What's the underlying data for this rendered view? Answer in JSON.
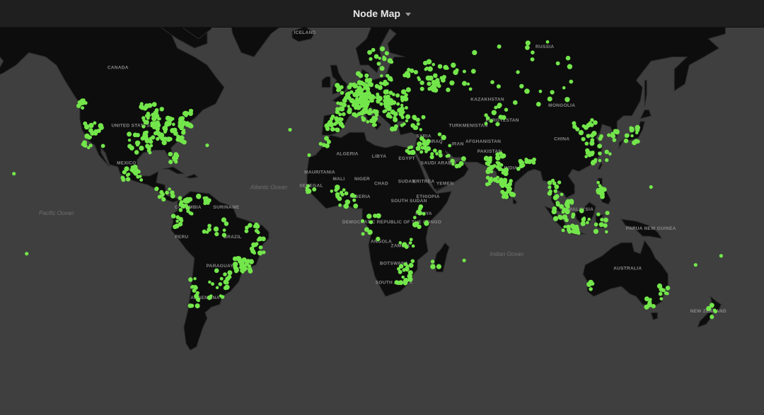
{
  "panel": {
    "title": "Node Map",
    "menu_icon": "caret-down-icon"
  },
  "map": {
    "type": "world-point-map",
    "colors": {
      "land": "#0d0d0d",
      "ocean": "#3f3f3f",
      "node": "#73e64b",
      "header": "#1f1f20"
    },
    "country_labels": [
      {
        "id": "canada",
        "text": "CANADA",
        "lon": -106,
        "lat": 57
      },
      {
        "id": "united-states",
        "text": "UNITED STATES",
        "lon": -100,
        "lat": 39
      },
      {
        "id": "mexico",
        "text": "MEXICO",
        "lon": -102,
        "lat": 24
      },
      {
        "id": "colombia",
        "text": "COLOMBIA",
        "lon": -73,
        "lat": 4
      },
      {
        "id": "suriname",
        "text": "SURINAME",
        "lon": -55,
        "lat": 4
      },
      {
        "id": "peru",
        "text": "PERU",
        "lon": -76,
        "lat": -10
      },
      {
        "id": "brazil",
        "text": "BRAZIL",
        "lon": -52,
        "lat": -10
      },
      {
        "id": "paraguay",
        "text": "PARAGUAY",
        "lon": -58,
        "lat": -23
      },
      {
        "id": "argentina",
        "text": "ARGENTINA",
        "lon": -65,
        "lat": -36
      },
      {
        "id": "iceland",
        "text": "ICELAND",
        "lon": -18,
        "lat": 65
      },
      {
        "id": "algeria",
        "text": "ALGERIA",
        "lon": 2,
        "lat": 28
      },
      {
        "id": "libya",
        "text": "LIBYA",
        "lon": 17,
        "lat": 27
      },
      {
        "id": "egypt",
        "text": "EGYPT",
        "lon": 30,
        "lat": 26
      },
      {
        "id": "mauritania",
        "text": "MAURITANIA",
        "lon": -11,
        "lat": 20
      },
      {
        "id": "mali",
        "text": "MALI",
        "lon": -2,
        "lat": 17
      },
      {
        "id": "niger",
        "text": "NIGER",
        "lon": 9,
        "lat": 17
      },
      {
        "id": "chad",
        "text": "CHAD",
        "lon": 18,
        "lat": 15
      },
      {
        "id": "senegal",
        "text": "SENEGAL",
        "lon": -15,
        "lat": 14
      },
      {
        "id": "sudan",
        "text": "SUDAN",
        "lon": 30,
        "lat": 16
      },
      {
        "id": "eritrea",
        "text": "ERITREA",
        "lon": 38,
        "lat": 16
      },
      {
        "id": "south-sudan",
        "text": "SOUTH SUDAN",
        "lon": 31,
        "lat": 7
      },
      {
        "id": "ethiopia",
        "text": "ETHIOPIA",
        "lon": 40,
        "lat": 9
      },
      {
        "id": "nigeria",
        "text": "NIGERIA",
        "lon": 8,
        "lat": 9
      },
      {
        "id": "kenya",
        "text": "KENYA",
        "lon": 38,
        "lat": 1
      },
      {
        "id": "drc",
        "text": "DEMOCRATIC REPUBLIC OF THE CONGO",
        "lon": 23,
        "lat": -3
      },
      {
        "id": "angola",
        "text": "ANGOLA",
        "lon": 18,
        "lat": -12
      },
      {
        "id": "zambia",
        "text": "ZAMBIA",
        "lon": 27,
        "lat": -14
      },
      {
        "id": "botswana",
        "text": "BOTSWANA",
        "lon": 24,
        "lat": -22
      },
      {
        "id": "south-africa",
        "text": "SOUTH AFRICA",
        "lon": 24,
        "lat": -30
      },
      {
        "id": "russia",
        "text": "RUSSIA",
        "lon": 95,
        "lat": 62
      },
      {
        "id": "kazakhstan",
        "text": "KAZAKHSTAN",
        "lon": 68,
        "lat": 48
      },
      {
        "id": "mongolia",
        "text": "MONGOLIA",
        "lon": 103,
        "lat": 46
      },
      {
        "id": "turkmenistan",
        "text": "TURKMENISTAN",
        "lon": 59,
        "lat": 39
      },
      {
        "id": "kyrgyzstan",
        "text": "KYRGYZSTAN",
        "lon": 75,
        "lat": 41
      },
      {
        "id": "china",
        "text": "CHINA",
        "lon": 103,
        "lat": 34
      },
      {
        "id": "afghanistan",
        "text": "AFGHANISTAN",
        "lon": 66,
        "lat": 33
      },
      {
        "id": "pakistan",
        "text": "PAKISTAN",
        "lon": 69,
        "lat": 29
      },
      {
        "id": "iraq",
        "text": "IRAQ",
        "lon": 44,
        "lat": 33
      },
      {
        "id": "iran",
        "text": "IRAN",
        "lon": 54,
        "lat": 32
      },
      {
        "id": "syria",
        "text": "SYRIA",
        "lon": 38,
        "lat": 35
      },
      {
        "id": "saudi-arabia",
        "text": "SAUDI ARABIA",
        "lon": 45,
        "lat": 24
      },
      {
        "id": "yemen",
        "text": "YEMEN",
        "lon": 48,
        "lat": 15
      },
      {
        "id": "india",
        "text": "INDIA",
        "lon": 79,
        "lat": 22
      },
      {
        "id": "malaysia",
        "text": "MALAYSIA",
        "lon": 112,
        "lat": 3
      },
      {
        "id": "papua-new-guinea",
        "text": "PAPUA NEW GUINEA",
        "lon": 145,
        "lat": -6
      },
      {
        "id": "australia",
        "text": "AUSTRALIA",
        "lon": 134,
        "lat": -24
      },
      {
        "id": "new-zealand",
        "text": "NEW ZEALAND",
        "lon": 172,
        "lat": -41
      }
    ],
    "ocean_labels": [
      {
        "id": "atlantic",
        "text": "Atlantic Ocean",
        "lon": -35,
        "lat": 13
      },
      {
        "id": "pacific",
        "text": "Pacific Ocean",
        "lon": -135,
        "lat": 1
      },
      {
        "id": "indian",
        "text": "Indian Ocean",
        "lon": 77,
        "lat": -18
      }
    ]
  }
}
